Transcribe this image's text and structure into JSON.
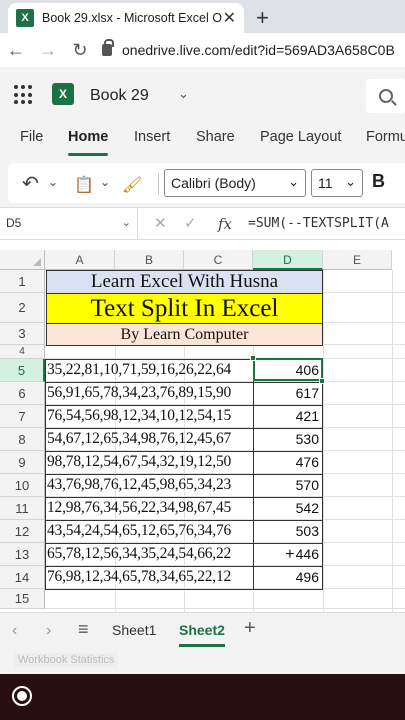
{
  "browser": {
    "tab_title": "Book 29.xlsx - Microsoft Excel O",
    "tab_favicon": "X",
    "close_glyph": "✕",
    "new_tab_glyph": "+",
    "url": "onedrive.live.com/edit?id=569AD3A658C0B"
  },
  "app": {
    "logo_letter": "X",
    "doc_name": "Book 29",
    "accent": "#1e7145"
  },
  "ribbon_tabs": [
    "File",
    "Home",
    "Insert",
    "Share",
    "Page Layout",
    "Formu"
  ],
  "toolbar": {
    "font_name": "Calibri (Body)",
    "font_size": "11",
    "bold_label": "B"
  },
  "formula_bar": {
    "name_box": "D5",
    "fx_label": "fx",
    "formula": "=SUM(--TEXTSPLIT(A"
  },
  "grid": {
    "columns": [
      "A",
      "B",
      "C",
      "D",
      "E"
    ],
    "selected_column": "D",
    "rows": [
      "1",
      "2",
      "3",
      "4",
      "5",
      "6",
      "7",
      "8",
      "9",
      "10",
      "11",
      "12",
      "13",
      "14",
      "15"
    ],
    "selected_row": "5",
    "title1": "Learn Excel With Husna",
    "title2": "Text Split In Excel",
    "title3": "By Learn Computer",
    "data": [
      {
        "text": "35,22,81,10,71,59,16,26,22,64",
        "sum": "406"
      },
      {
        "text": "56,91,65,78,34,23,76,89,15,90",
        "sum": "617"
      },
      {
        "text": "76,54,56,98,12,34,10,12,54,15",
        "sum": "421"
      },
      {
        "text": "54,67,12,65,34,98,76,12,45,67",
        "sum": "530"
      },
      {
        "text": "98,78,12,54,67,54,32,19,12,50",
        "sum": "476"
      },
      {
        "text": "43,76,98,76,12,45,98,65,34,23",
        "sum": "570"
      },
      {
        "text": "12,98,76,34,56,22,34,98,67,45",
        "sum": "542"
      },
      {
        "text": "43,54,24,54,65,12,65,76,34,76",
        "sum": "503"
      },
      {
        "text": "65,78,12,56,34,35,24,54,66,22",
        "sum": "446",
        "cursor": "+"
      },
      {
        "text": "76,98,12,34,65,78,34,65,22,12",
        "sum": "496"
      }
    ]
  },
  "sheets": {
    "tabs": [
      "Sheet1",
      "Sheet2"
    ],
    "active": "Sheet2"
  },
  "status": {
    "text": "Workbook Statistics"
  }
}
